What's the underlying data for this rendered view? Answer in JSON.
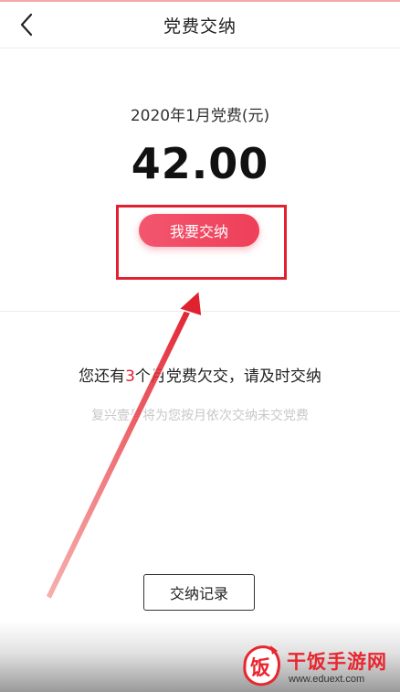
{
  "header": {
    "title": "党费交纳",
    "back_icon": "chevron-left-icon"
  },
  "fee": {
    "period_label": "2020年1月党费(元)",
    "amount": "42.00",
    "pay_button_label": "我要交纳"
  },
  "arrears": {
    "prefix": "您还有",
    "count": "3",
    "suffix": "个月党费欠交，请及时交纳",
    "hint": "复兴壹号将为您按月依次交纳未交党费"
  },
  "records_button_label": "交纳记录",
  "watermark": {
    "logo_char": "饭",
    "text": "干饭手游网",
    "url": "www.eduext.com"
  },
  "colors": {
    "accent": "#ee3f58",
    "annotation_red": "#e0212f",
    "count_red": "#e0212f",
    "hint_gray": "#c8c8c8"
  }
}
